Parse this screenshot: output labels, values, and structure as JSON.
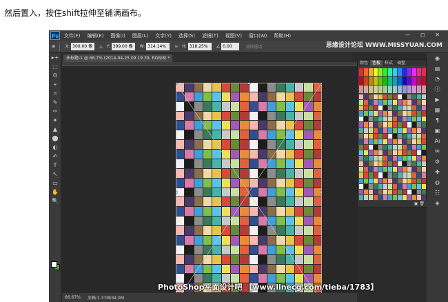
{
  "caption": "然后置入，按住shift拉伸至铺满画布。",
  "menu": {
    "logo": "Ps",
    "items": [
      "文件(F)",
      "编辑(E)",
      "图像(I)",
      "图层(L)",
      "文字(Y)",
      "选择(S)",
      "滤镜(T)",
      "视图(V)",
      "窗口(W)",
      "帮助(H)"
    ],
    "window_controls": "— ◻ ✕"
  },
  "options": {
    "x_label": "X:",
    "x_value": "300.00 像",
    "y_label": "Y:",
    "y_value": "399.00 像",
    "w_label": "W:",
    "w_value": "314.14%",
    "h_label": "H:",
    "h_value": "318.25%",
    "rot_value": "0.00",
    "interp": "消除锯齿"
  },
  "watermark": "思缘设计论坛 WWW.MISSYUAN.COM",
  "document_tab": "未标题-1 @ 66.7% (2014-04-25 09 19 39, RGB/8) *",
  "status": {
    "zoom": "66.67%",
    "doc": "文档:1.37M/34.0M"
  },
  "banner": "PhotoShop平面设计吧 【www.linecg.com/tieba/1783】",
  "panel": {
    "tabs": [
      "颜色",
      "色板",
      "样式",
      "调整"
    ],
    "active_tab": "色板",
    "footer": "▣ 🗑"
  },
  "tools": [
    "▸+",
    "⬚",
    "ʘ",
    "⌖",
    "⌗",
    "✎",
    "✑",
    "✦",
    "▲",
    "⬤",
    "◐",
    "✍",
    "T",
    "↖",
    "▭",
    "✋",
    "🔍"
  ],
  "right_icons": [
    "◉",
    "▤",
    "◔",
    "ⓘ",
    "▶",
    "▦",
    "¶",
    "▣",
    "Aı",
    "✉",
    "⚙",
    "✚",
    "◍",
    "☷",
    "◈"
  ]
}
